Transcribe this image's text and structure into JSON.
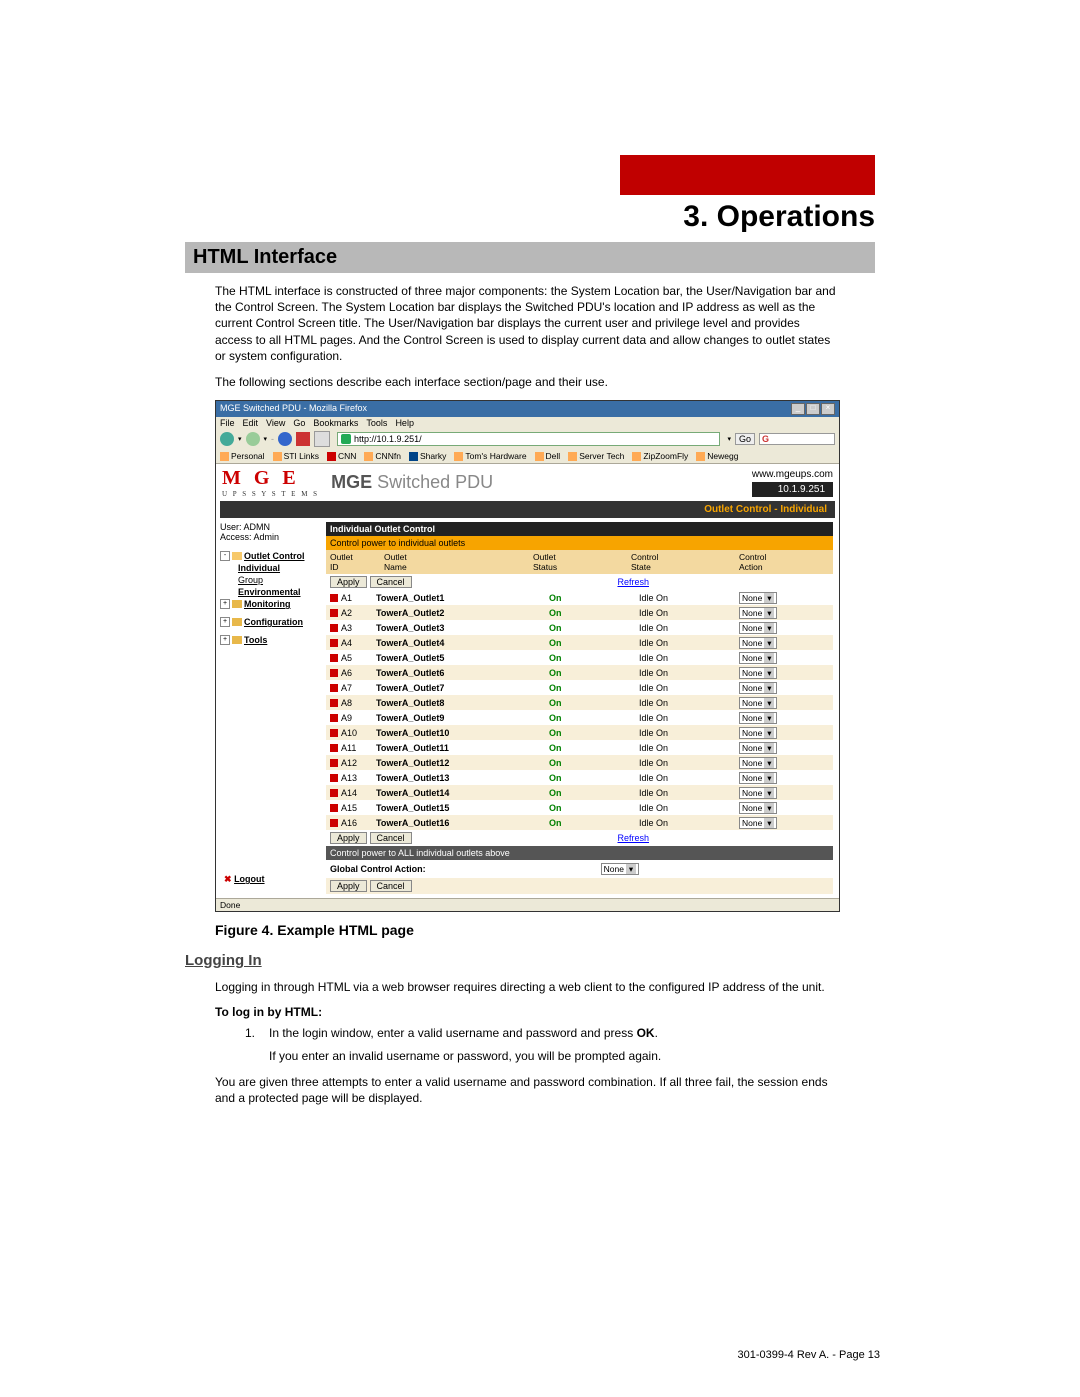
{
  "chapter_title": "3. Operations",
  "section_title": "HTML Interface",
  "para1": "The HTML interface is constructed of three major components: the System Location bar, the User/Navigation bar and the Control Screen.  The System Location bar displays the Switched PDU's location and IP address as well as the current Control Screen title.  The User/Navigation bar displays the current user and privilege level and provides access to all HTML pages.  And the Control Screen is used to display current data and allow changes to outlet states or system configuration.",
  "para2": "The following sections describe each interface section/page and their use.",
  "figure_caption": "Figure 4.  Example HTML page",
  "loggingin_title": "Logging In",
  "loggingin_text": "Logging in through HTML via a web browser requires directing a web client to the configured IP address of the unit.",
  "subhead": "To log in by HTML:",
  "step1_prefix": "In the login window, enter a valid username and password and press ",
  "step1_bold": "OK",
  "step1_suffix": ".",
  "step1_note": "If you enter an invalid username or password, you will be prompted again.",
  "step_after": "You are given three attempts to enter a valid username and password combination. If all three fail, the session ends and a protected page will be displayed.",
  "footer": "301-0399-4 Rev A. - Page 13",
  "screenshot": {
    "ff_title": "MGE Switched PDU - Mozilla Firefox",
    "menu": [
      "File",
      "Edit",
      "View",
      "Go",
      "Bookmarks",
      "Tools",
      "Help"
    ],
    "url": "http://10.1.9.251/",
    "go_label": "Go",
    "bookmarks": [
      "Personal",
      "STI Links",
      "CNN",
      "CNNfn",
      "Sharky",
      "Tom's Hardware",
      "Dell",
      "Server Tech",
      "ZipZoomFly",
      "Newegg"
    ],
    "logo_main": "M G E",
    "logo_sub": "U P S  S Y S T E M S",
    "prod_a": "MGE",
    "prod_b": "Switched",
    "prod_c": "PDU",
    "site": "www.mgeups.com",
    "ip": "10.1.9.251",
    "panel_title": "Outlet Control - Individual",
    "user_label": "User: ADMN",
    "access_label": "Access: Admin",
    "nav": {
      "outlet_control": "Outlet Control",
      "individual": "Individual",
      "group": "Group",
      "environmental": "Environmental",
      "monitoring": "Monitoring",
      "configuration": "Configuration",
      "tools": "Tools"
    },
    "logout": "Logout",
    "tbl_header": "Individual Outlet Control",
    "tbl_sub": "Control power to individual outlets",
    "col_id": "Outlet\nID",
    "col_name": "Outlet\nName",
    "col_status": "Outlet\nStatus",
    "col_cstate": "Control\nState",
    "col_caction": "Control\nAction",
    "apply": "Apply",
    "cancel": "Cancel",
    "refresh": "Refresh",
    "outlets": [
      {
        "id": "A1",
        "name": "TowerA_Outlet1",
        "status": "On",
        "cstate": "Idle On",
        "action": "None"
      },
      {
        "id": "A2",
        "name": "TowerA_Outlet2",
        "status": "On",
        "cstate": "Idle On",
        "action": "None"
      },
      {
        "id": "A3",
        "name": "TowerA_Outlet3",
        "status": "On",
        "cstate": "Idle On",
        "action": "None"
      },
      {
        "id": "A4",
        "name": "TowerA_Outlet4",
        "status": "On",
        "cstate": "Idle On",
        "action": "None"
      },
      {
        "id": "A5",
        "name": "TowerA_Outlet5",
        "status": "On",
        "cstate": "Idle On",
        "action": "None"
      },
      {
        "id": "A6",
        "name": "TowerA_Outlet6",
        "status": "On",
        "cstate": "Idle On",
        "action": "None"
      },
      {
        "id": "A7",
        "name": "TowerA_Outlet7",
        "status": "On",
        "cstate": "Idle On",
        "action": "None"
      },
      {
        "id": "A8",
        "name": "TowerA_Outlet8",
        "status": "On",
        "cstate": "Idle On",
        "action": "None"
      },
      {
        "id": "A9",
        "name": "TowerA_Outlet9",
        "status": "On",
        "cstate": "Idle On",
        "action": "None"
      },
      {
        "id": "A10",
        "name": "TowerA_Outlet10",
        "status": "On",
        "cstate": "Idle On",
        "action": "None"
      },
      {
        "id": "A11",
        "name": "TowerA_Outlet11",
        "status": "On",
        "cstate": "Idle On",
        "action": "None"
      },
      {
        "id": "A12",
        "name": "TowerA_Outlet12",
        "status": "On",
        "cstate": "Idle On",
        "action": "None"
      },
      {
        "id": "A13",
        "name": "TowerA_Outlet13",
        "status": "On",
        "cstate": "Idle On",
        "action": "None"
      },
      {
        "id": "A14",
        "name": "TowerA_Outlet14",
        "status": "On",
        "cstate": "Idle On",
        "action": "None"
      },
      {
        "id": "A15",
        "name": "TowerA_Outlet15",
        "status": "On",
        "cstate": "Idle On",
        "action": "None"
      },
      {
        "id": "A16",
        "name": "TowerA_Outlet16",
        "status": "On",
        "cstate": "Idle On",
        "action": "None"
      }
    ],
    "tbl_sub2": "Control power to ALL individual outlets above",
    "global_label": "Global Control Action:",
    "global_value": "None",
    "status_bar": "Done"
  }
}
